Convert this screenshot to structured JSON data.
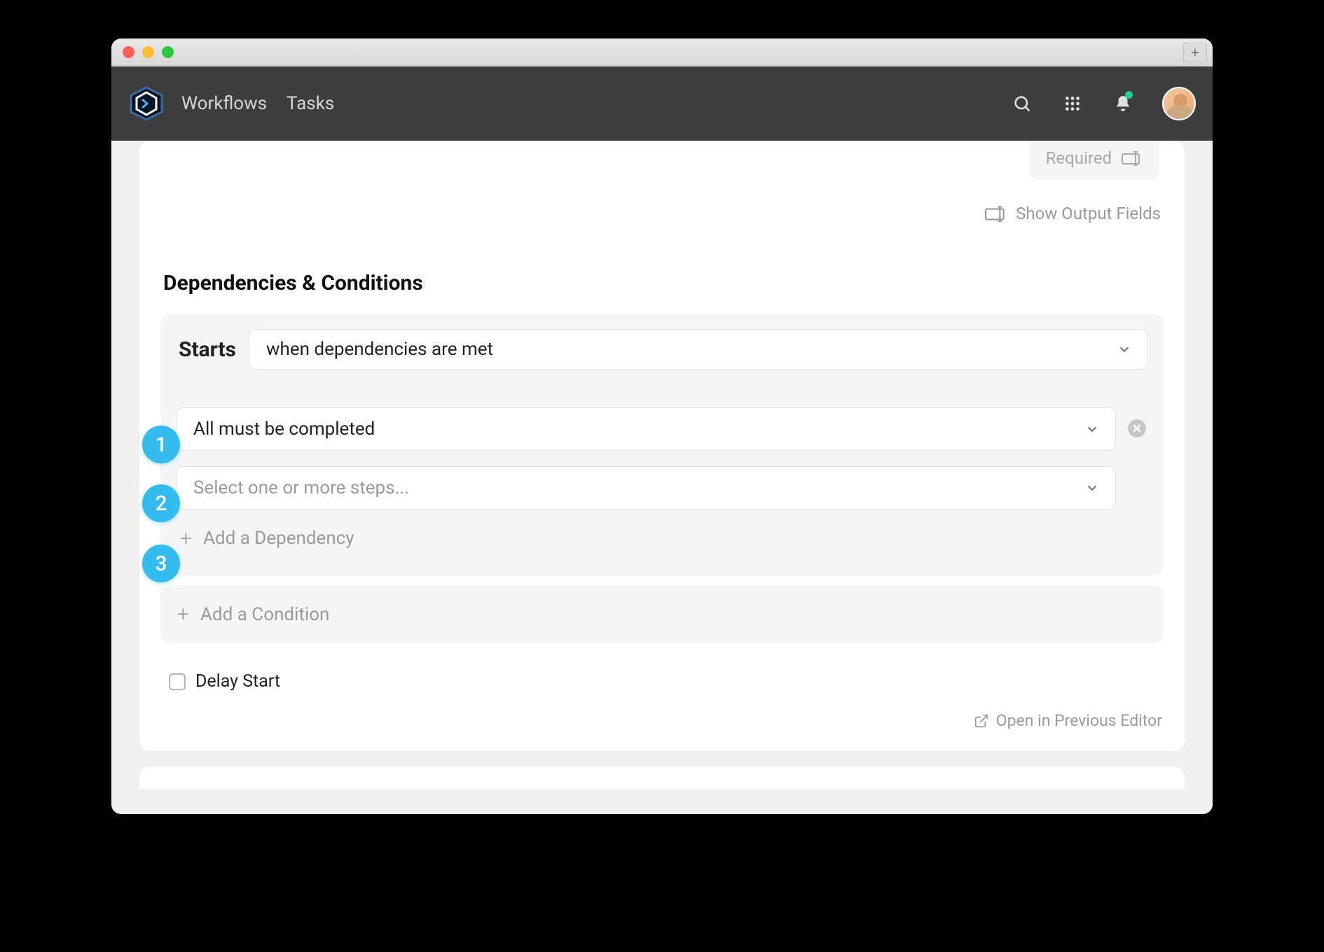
{
  "badges": {
    "b1": "1",
    "b2": "2",
    "b3": "3"
  },
  "header": {
    "nav": {
      "workflows": "Workflows",
      "tasks": "Tasks"
    }
  },
  "required_label": "Required",
  "output_fields_label": "Show Output Fields",
  "section_title": "Dependencies & Conditions",
  "starts": {
    "label": "Starts",
    "value": "when dependencies are met"
  },
  "dependency": {
    "rule": "All must be completed",
    "steps_placeholder": "Select one or more steps...",
    "add_label": "Add a Dependency"
  },
  "condition": {
    "add_label": "Add a Condition"
  },
  "delay_label": "Delay Start",
  "footer_link": "Open in Previous Editor"
}
